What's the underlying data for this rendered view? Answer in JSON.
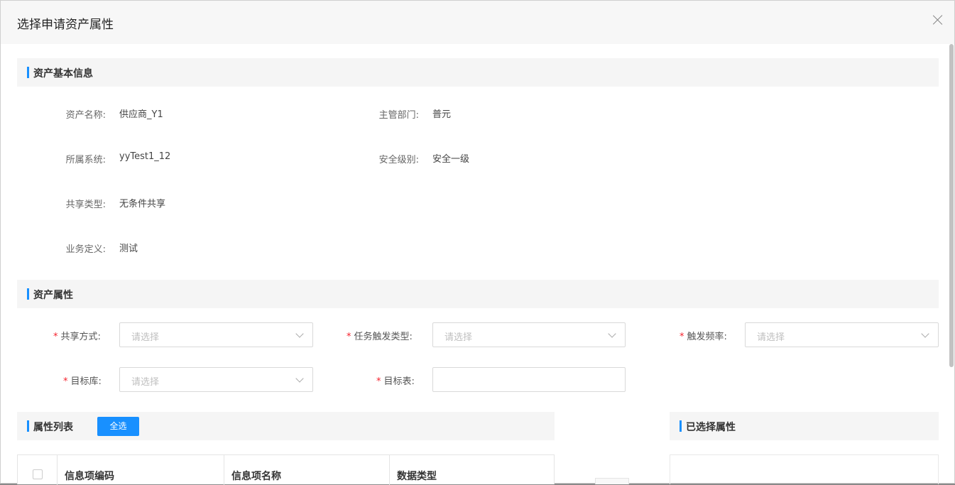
{
  "modal": {
    "title": "选择申请资产属性"
  },
  "basic_info": {
    "heading": "资产基本信息",
    "fields": [
      {
        "label": "资产名称:",
        "value": "供应商_Y1"
      },
      {
        "label": "主管部门:",
        "value": "普元"
      },
      {
        "label": "所属系统:",
        "value": "yyTest1_12"
      },
      {
        "label": "安全级别:",
        "value": "安全一级"
      },
      {
        "label": "共享类型:",
        "value": "无条件共享"
      },
      {
        "label": "业务定义:",
        "value": "测试"
      }
    ]
  },
  "asset_attrs": {
    "heading": "资产属性",
    "required_mark": "*",
    "share_mode": {
      "label": "共享方式:",
      "placeholder": "请选择"
    },
    "trigger_type": {
      "label": "任务触发类型:",
      "placeholder": "请选择"
    },
    "trigger_freq": {
      "label": "触发频率:",
      "placeholder": "请选择"
    },
    "target_db": {
      "label": "目标库:",
      "placeholder": "请选择"
    },
    "target_table": {
      "label": "目标表:",
      "value": ""
    }
  },
  "attr_list": {
    "heading": "属性列表",
    "select_all_label": "全选",
    "columns": [
      "信息项编码",
      "信息项名称",
      "数据类型"
    ]
  },
  "selected_attrs": {
    "heading": "已选择属性"
  },
  "icons": {
    "close": "close-icon",
    "dropdown": "chevron-down-icon"
  },
  "colors": {
    "accent": "#1890ff",
    "required": "#f5222d"
  }
}
